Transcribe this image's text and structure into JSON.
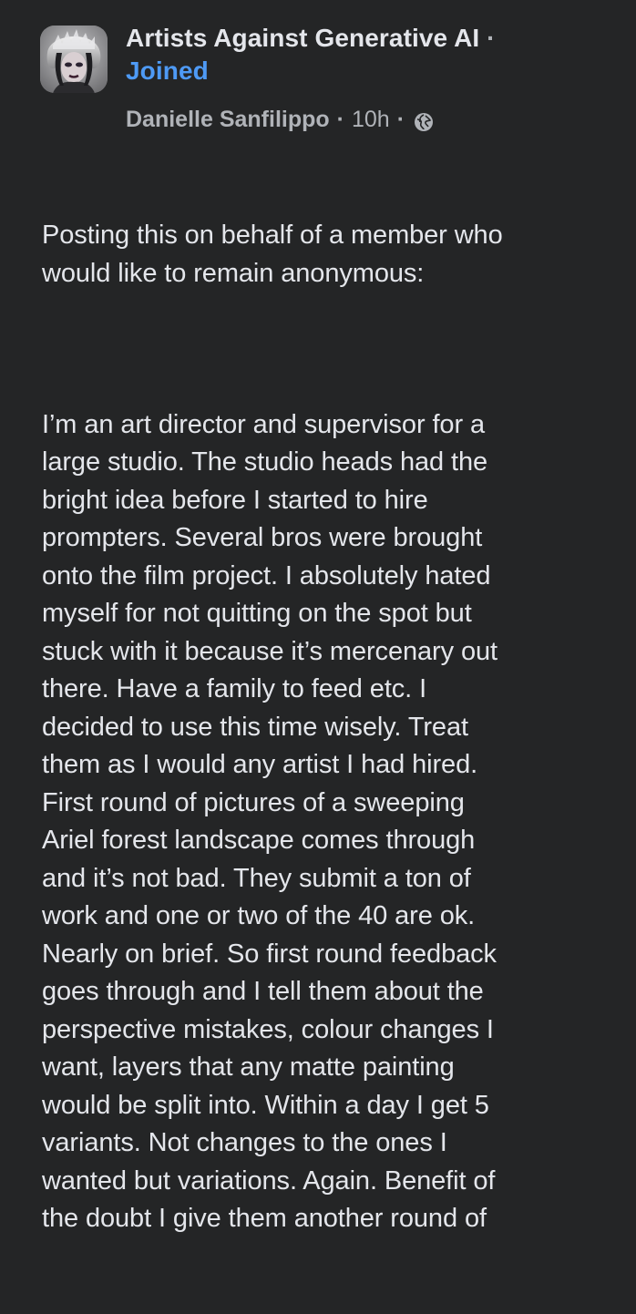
{
  "group": {
    "name": "Artists Against Generative AI",
    "separator": "·",
    "status": "Joined"
  },
  "meta": {
    "author": "Danielle Sanfilippo",
    "separator": "·",
    "time": "10h",
    "audience_icon": "globe-icon"
  },
  "post": {
    "intro": "Posting this on behalf of a member who\nwould like to remain anonymous:",
    "body": "I’m an art director and supervisor for a\nlarge studio. The studio heads had the\nbright idea before I started to hire\nprompters. Several bros were brought\nonto the film project. I absolutely hated\nmyself for not quitting on the spot but\nstuck with it because it’s mercenary out\nthere. Have a family to feed etc. I\ndecided to use this time wisely. Treat\nthem as I would any artist I had hired.\nFirst round of pictures of a sweeping\nAriel forest landscape comes through\nand it’s not bad. They submit a ton of\nwork and one or two of the 40 are ok.\nNearly on brief. So first round feedback\ngoes through and I tell them about the\nperspective mistakes, colour changes I\nwant, layers that any matte painting\nwould be split into. Within a day I get 5\nvariants. Not changes to the ones I\nwanted but variations. Again. Benefit of\nthe doubt I give them another round of"
  },
  "colors": {
    "background": "#242526",
    "text": "#e4e6eb",
    "secondary": "#b0b3b8",
    "link": "#4e9af5"
  }
}
